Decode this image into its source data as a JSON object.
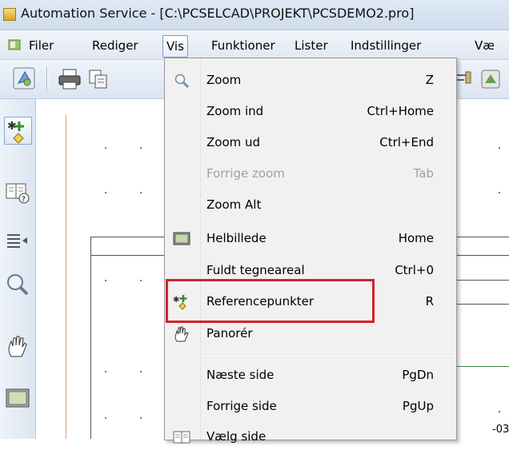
{
  "window": {
    "title": "Automation Service - [C:\\PCSELCAD\\PROJEKT\\PCSDEMO2.pro]"
  },
  "menubar": {
    "items": [
      "Filer",
      "Rediger",
      "Vis",
      "Funktioner",
      "Lister",
      "Indstillinger",
      "Væ"
    ],
    "active": "Vis"
  },
  "toolbar": {
    "icons": [
      "project-icon",
      "print-icon",
      "copy-icon",
      "tool-icon",
      "tool2-icon"
    ]
  },
  "left_tools": {
    "icons": [
      "reference-points-tool-icon",
      "help-book-icon",
      "list-arrow-icon",
      "zoom-magnifier-icon",
      "pan-hand-icon",
      "full-image-icon"
    ]
  },
  "canvas": {
    "bottom_label": "-03"
  },
  "vis_menu": {
    "items": [
      {
        "label": "Zoom",
        "shortcut": "Z",
        "icon": "magnifier-icon",
        "enabled": true
      },
      {
        "label": "Zoom ind",
        "shortcut": "Ctrl+Home",
        "enabled": true
      },
      {
        "label": "Zoom ud",
        "shortcut": "Ctrl+End",
        "enabled": true
      },
      {
        "label": "Forrige zoom",
        "shortcut": "Tab",
        "enabled": false
      },
      {
        "label": "Zoom Alt",
        "shortcut": "",
        "enabled": true
      },
      {
        "label": "Helbillede",
        "shortcut": "Home",
        "icon": "monitor-icon",
        "enabled": true
      },
      {
        "label": "Fuldt tegneareal",
        "shortcut": "Ctrl+0",
        "enabled": true
      },
      {
        "label": "Referencepunkter",
        "shortcut": "R",
        "icon": "reference-points-icon",
        "enabled": true,
        "highlighted": true
      },
      {
        "label": "Panorér",
        "shortcut": "",
        "icon": "hand-icon",
        "enabled": true
      },
      {
        "label": "Næste side",
        "shortcut": "PgDn",
        "enabled": true
      },
      {
        "label": "Forrige side",
        "shortcut": "PgUp",
        "enabled": true
      },
      {
        "label": "Vælg side",
        "shortcut": "",
        "icon": "book-icon",
        "enabled": true
      }
    ]
  },
  "colors": {
    "highlight_box": "#d2232a",
    "disabled_text": "#a0a0a0"
  }
}
